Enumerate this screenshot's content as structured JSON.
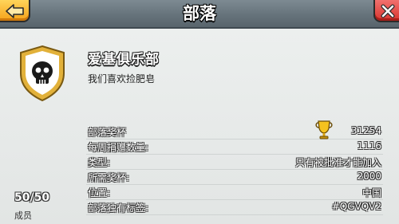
{
  "header": {
    "title": "部落",
    "back_icon": "back-arrow-icon",
    "close_icon": "close-icon",
    "colors": {
      "back": "#f6a21a",
      "close": "#d8352f",
      "bar": "#66737b"
    }
  },
  "clan": {
    "name": "爱基俱乐部",
    "description": "我们喜欢捡肥皂",
    "badge_icon": "skull-shield-badge-icon"
  },
  "stats": [
    {
      "label": "部落奖杯",
      "value": "31254"
    },
    {
      "label": "每周捐赠数量:",
      "value": "1116"
    },
    {
      "label": "类型:",
      "value": "只有被批准才能加入"
    },
    {
      "label": "所需奖杯:",
      "value": "2000"
    },
    {
      "label": "位置:",
      "value": "中国"
    },
    {
      "label": "部落独有标签:",
      "value": "#QGVQV2"
    }
  ],
  "trophy_icon": "trophy-icon",
  "members": {
    "count": "50/50",
    "label": "成员"
  }
}
